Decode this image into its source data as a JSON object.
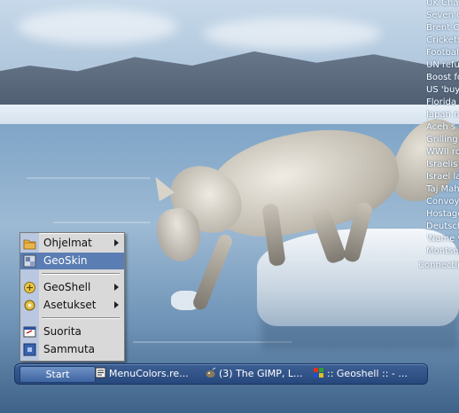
{
  "news": {
    "items": [
      "UK Cha",
      "Seven c",
      "Brent C",
      "Cricket:",
      "Footbal",
      "UN refu",
      "Boost fo",
      "US 'buy",
      "Florida a",
      "Japan n",
      "Aceh s",
      "Grilling",
      "WWII ro",
      "Israelis",
      "Israel la",
      "Taj Mah",
      "Convoy",
      "Hostage",
      "Deutsch",
      "'Name v",
      "Montse"
    ],
    "status": "Connecting"
  },
  "menu": {
    "items": [
      {
        "label": "Ohjelmat",
        "icon": "programs-folder-icon",
        "submenu": true
      },
      {
        "label": "GeoSkin",
        "icon": "geoskin-icon",
        "submenu": false,
        "highlighted": true
      },
      {
        "label": "GeoShell",
        "icon": "geoshell-icon",
        "submenu": true
      },
      {
        "label": "Asetukset",
        "icon": "settings-icon",
        "submenu": true
      },
      {
        "label": "Suorita",
        "icon": "run-icon",
        "submenu": false
      },
      {
        "label": "Sammuta",
        "icon": "shutdown-icon",
        "submenu": false
      }
    ],
    "highlight_color": "#5a7db3"
  },
  "taskbar": {
    "start_label": "Start",
    "tasks": [
      {
        "label": "MenuColors.re...",
        "icon": "text-editor-icon"
      },
      {
        "label": "(3) The GIMP, L...",
        "icon": "gimp-icon"
      },
      {
        "label": ":: Geoshell :: - ...",
        "icon": "windows-flag-icon"
      }
    ],
    "accent": "#27487c"
  }
}
